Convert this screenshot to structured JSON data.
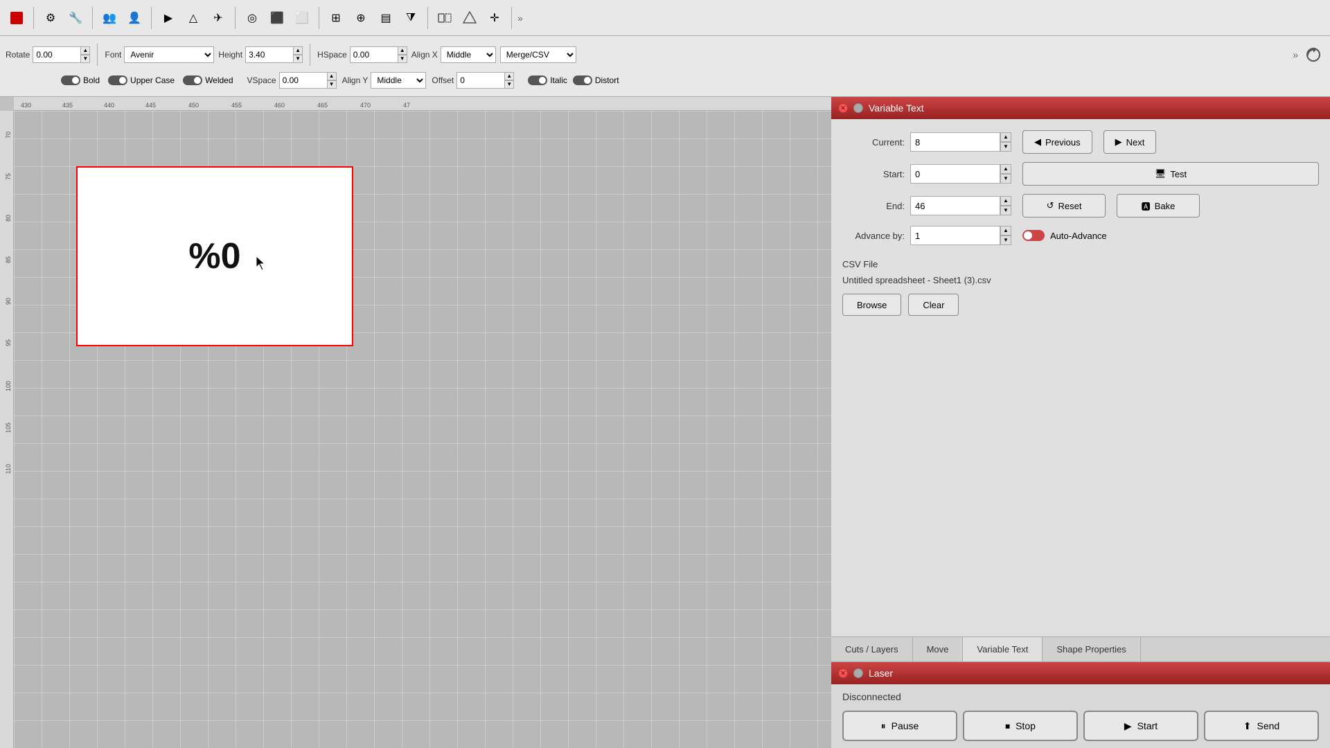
{
  "toolbar": {
    "icons": [
      "⚙",
      "🔧",
      "👥",
      "👤",
      "▶",
      "△",
      "✈",
      "◎",
      "⬛",
      "⬜",
      "⊞",
      "⊕",
      "▤",
      "⧩",
      "⬡",
      "⊕",
      "⊞",
      "✛"
    ]
  },
  "text_toolbar": {
    "rotate_label": "Rotate",
    "rotate_value": "0.00",
    "font_label": "Font",
    "font_value": "Avenir",
    "height_label": "Height",
    "height_value": "3.40",
    "hspace_label": "HSpace",
    "hspace_value": "0.00",
    "vspace_label": "VSpace",
    "vspace_value": "0.00",
    "align_x_label": "Align X",
    "align_x_value": "Middle",
    "align_y_label": "Align Y",
    "align_y_value": "Middle",
    "offset_label": "Offset",
    "offset_value": "0",
    "merge_csv_value": "Merge/CSV",
    "bold_label": "Bold",
    "italic_label": "Italic",
    "upper_case_label": "Upper Case",
    "distort_label": "Distort",
    "welded_label": "Welded"
  },
  "ruler": {
    "top_ticks": [
      "430",
      "435",
      "440",
      "445",
      "450",
      "455",
      "460",
      "465",
      "470"
    ],
    "left_ticks": [
      "70",
      "75",
      "80",
      "85",
      "90",
      "95",
      "100",
      "105",
      "110"
    ]
  },
  "canvas": {
    "rect_text": "%0"
  },
  "variable_text_panel": {
    "title": "Variable Text",
    "current_label": "Current:",
    "current_value": "8",
    "start_label": "Start:",
    "start_value": "0",
    "end_label": "End:",
    "end_value": "46",
    "advance_by_label": "Advance by:",
    "advance_by_value": "1",
    "previous_label": "Previous",
    "next_label": "Next",
    "test_label": "Test",
    "reset_label": "Reset",
    "bake_label": "Bake",
    "auto_advance_label": "Auto-Advance",
    "csv_file_label": "CSV File",
    "csv_filename": "Untitled spreadsheet - Sheet1 (3).csv",
    "browse_label": "Browse",
    "clear_label": "Clear"
  },
  "bottom_tabs": {
    "tabs": [
      {
        "label": "Cuts / Layers",
        "active": false
      },
      {
        "label": "Move",
        "active": false
      },
      {
        "label": "Variable Text",
        "active": true
      },
      {
        "label": "Shape Properties",
        "active": false
      }
    ]
  },
  "laser_panel": {
    "title": "Laser",
    "status": "Disconnected",
    "pause_label": "Pause",
    "stop_label": "Stop",
    "start_label": "Start",
    "send_label": "Send"
  }
}
